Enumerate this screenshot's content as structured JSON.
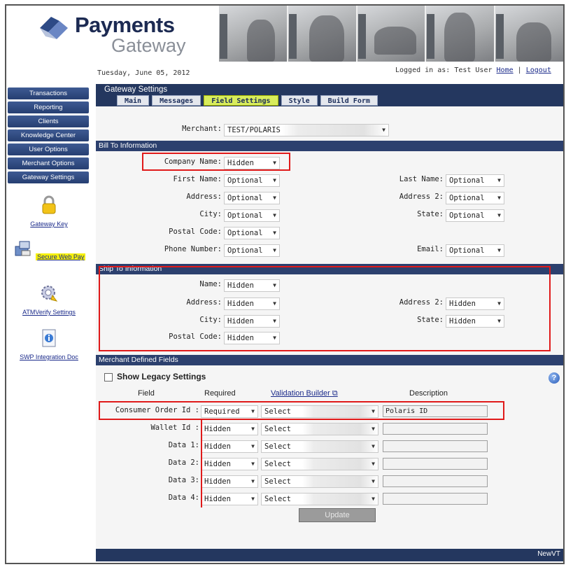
{
  "header": {
    "logo_title": "Payments",
    "logo_sub": "Gateway",
    "date": "Tuesday, June 05, 2012",
    "logged_in_prefix": "Logged in as:",
    "user_name": "Test User",
    "home_link": "Home",
    "separator": "|",
    "logout_link": "Logout"
  },
  "sidebar": {
    "nav": [
      {
        "label": "Transactions"
      },
      {
        "label": "Reporting"
      },
      {
        "label": "Clients"
      },
      {
        "label": "Knowledge Center"
      },
      {
        "label": "User Options"
      },
      {
        "label": "Merchant Options"
      },
      {
        "label": "Gateway Settings"
      }
    ],
    "tools": [
      {
        "label": "Gateway Key",
        "icon": "lock-icon"
      },
      {
        "label": "Secure Web Pay",
        "icon": "web-pay-icon"
      },
      {
        "label": "ATMVerify Settings",
        "icon": "gear-icon"
      },
      {
        "label": "SWP Integration Doc",
        "icon": "document-icon"
      }
    ]
  },
  "gateway": {
    "title": "Gateway Settings",
    "tabs": [
      "Main",
      "Messages",
      "Field Settings",
      "Style",
      "Build Form"
    ],
    "active_tab": "Field Settings"
  },
  "merchant": {
    "label": "Merchant:",
    "value": "TEST/POLARIS"
  },
  "bill_to": {
    "title": "Bill To Information",
    "company_name": {
      "label": "Company Name:",
      "value": "Hidden"
    },
    "first_name": {
      "label": "First Name:",
      "value": "Optional"
    },
    "last_name": {
      "label": "Last Name:",
      "value": "Optional"
    },
    "address": {
      "label": "Address:",
      "value": "Optional"
    },
    "address2": {
      "label": "Address 2:",
      "value": "Optional"
    },
    "city": {
      "label": "City:",
      "value": "Optional"
    },
    "state": {
      "label": "State:",
      "value": "Optional"
    },
    "postal_code": {
      "label": "Postal Code:",
      "value": "Optional"
    },
    "phone": {
      "label": "Phone Number:",
      "value": "Optional"
    },
    "email": {
      "label": "Email:",
      "value": "Optional"
    }
  },
  "ship_to": {
    "title": "Ship To Information",
    "name": {
      "label": "Name:",
      "value": "Hidden"
    },
    "address": {
      "label": "Address:",
      "value": "Hidden"
    },
    "address2": {
      "label": "Address 2:",
      "value": "Hidden"
    },
    "city": {
      "label": "City:",
      "value": "Hidden"
    },
    "state": {
      "label": "State:",
      "value": "Hidden"
    },
    "postal_code": {
      "label": "Postal Code:",
      "value": "Hidden"
    }
  },
  "merchant_fields": {
    "title": "Merchant Defined Fields",
    "legacy_label": "Show Legacy Settings",
    "col_field": "Field",
    "col_required": "Required",
    "col_validation": "Validation Builder",
    "col_description": "Description",
    "rows": [
      {
        "field": "Consumer Order Id :",
        "required": "Required",
        "validation": "Select",
        "description": "Polaris ID"
      },
      {
        "field": "Wallet Id :",
        "required": "Hidden",
        "validation": "Select",
        "description": ""
      },
      {
        "field": "Data 1:",
        "required": "Hidden",
        "validation": "Select",
        "description": ""
      },
      {
        "field": "Data 2:",
        "required": "Hidden",
        "validation": "Select",
        "description": ""
      },
      {
        "field": "Data 3:",
        "required": "Hidden",
        "validation": "Select",
        "description": ""
      },
      {
        "field": "Data 4:",
        "required": "Hidden",
        "validation": "Select",
        "description": ""
      }
    ],
    "update_button": "Update"
  },
  "footer": {
    "text": "NewVT"
  },
  "colors": {
    "nav": "#2c406e",
    "highlight": "#d8ec5c",
    "annotation": "#e01a1a"
  }
}
